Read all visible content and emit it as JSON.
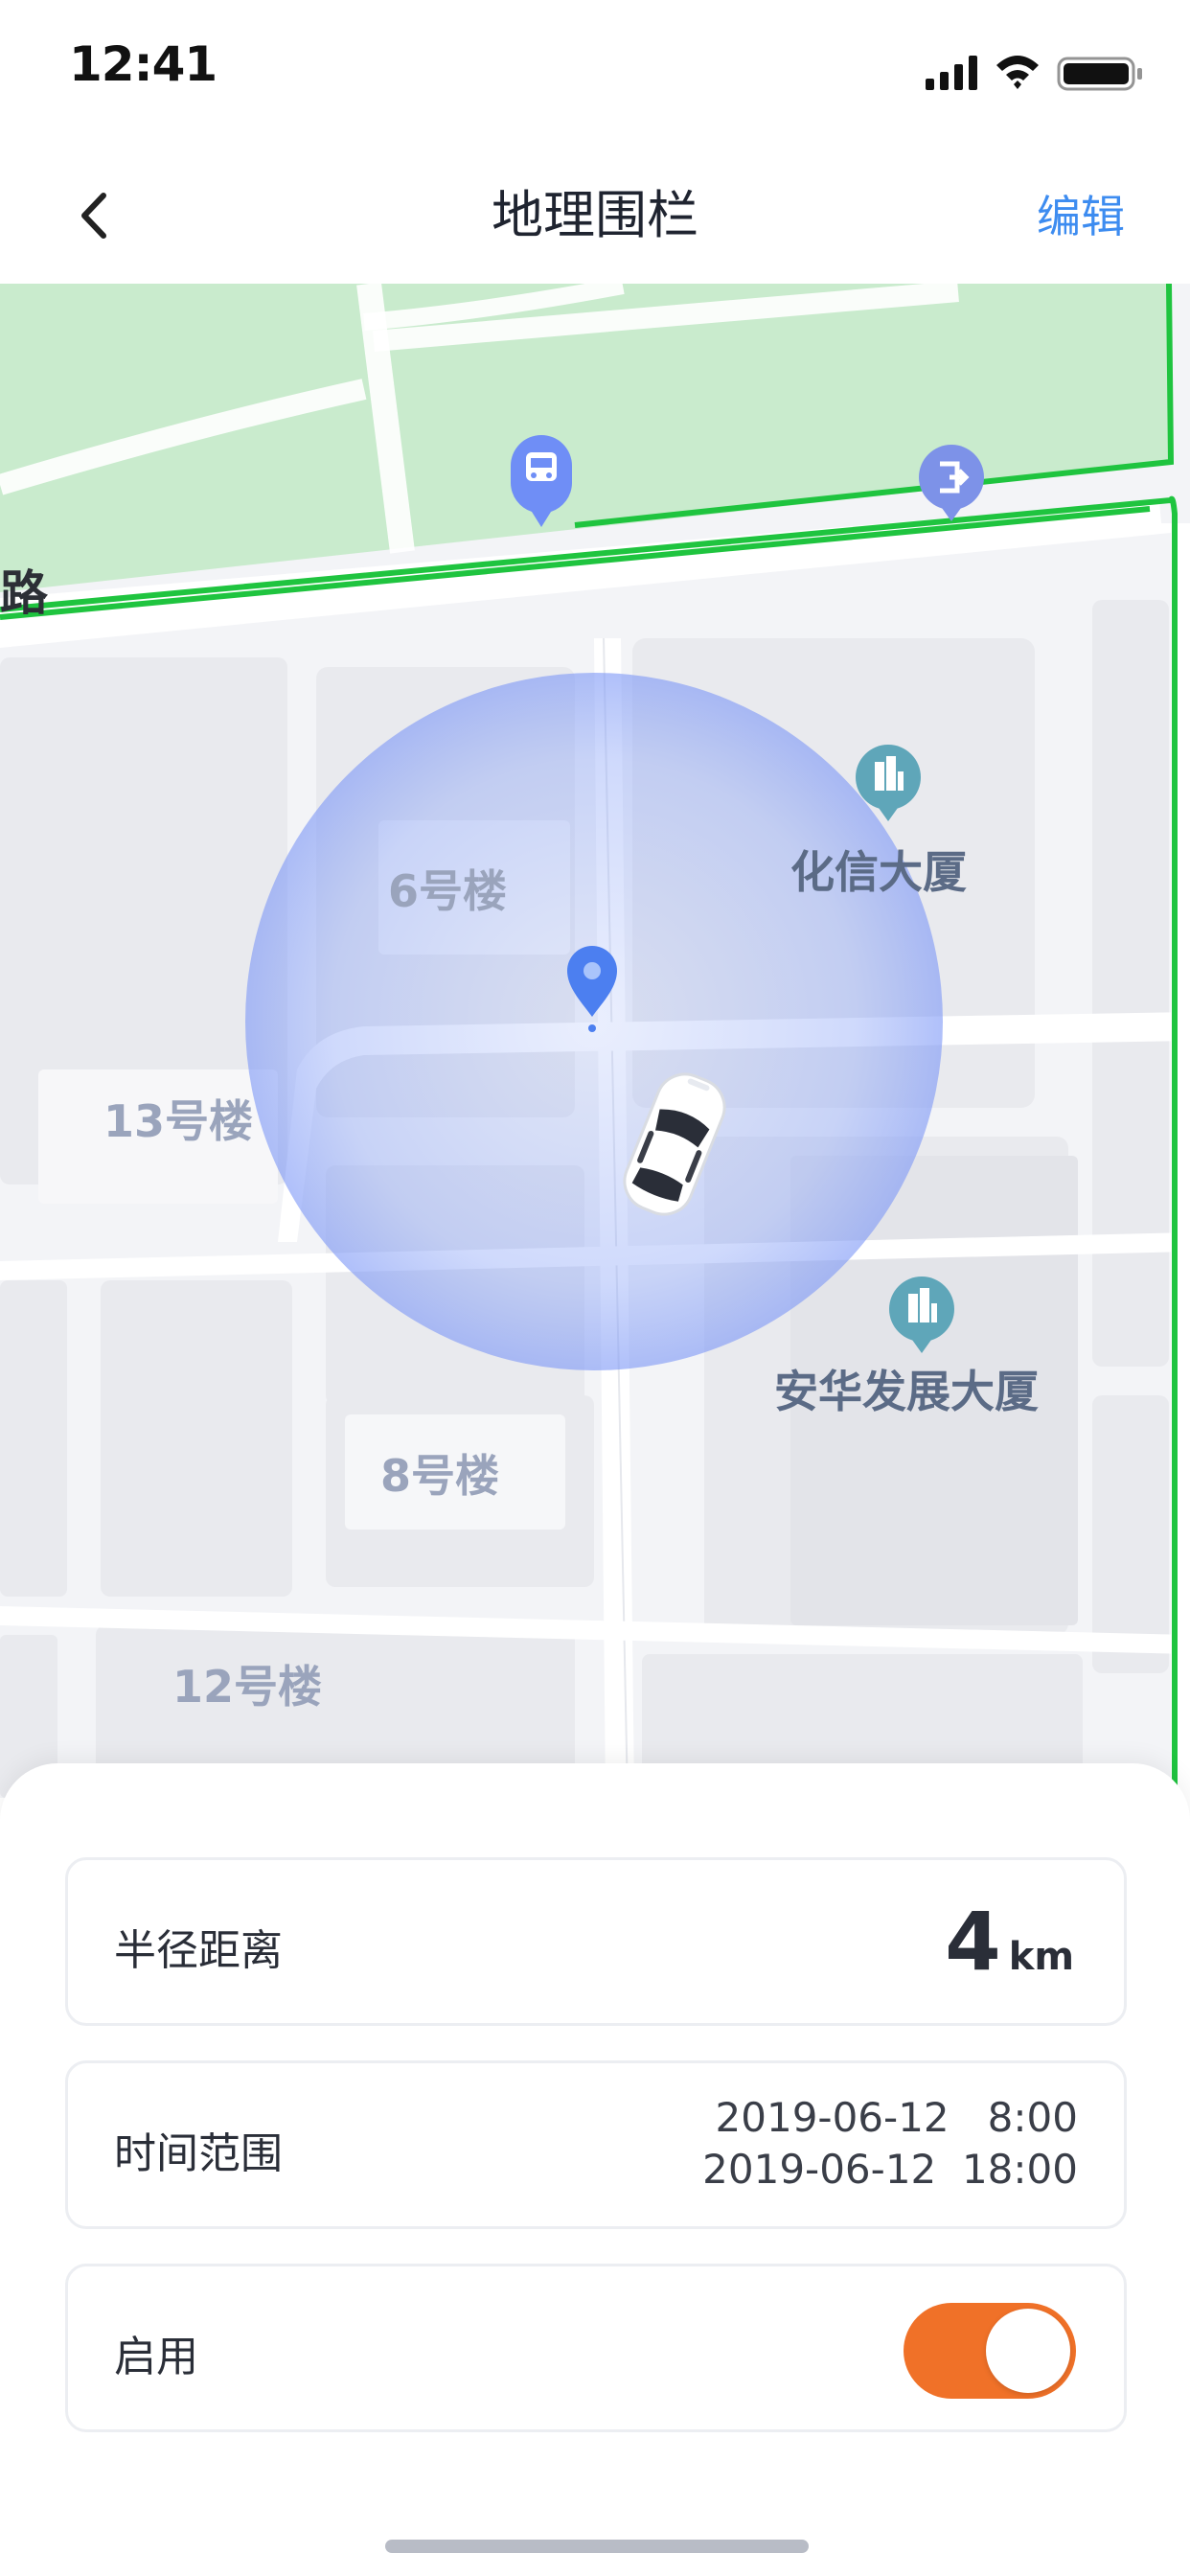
{
  "status_bar": {
    "time": "12:41",
    "icons": [
      "signal-icon",
      "wifi-icon",
      "battery-icon"
    ]
  },
  "nav": {
    "back_icon": "chevron-left-icon",
    "title": "地理围栏",
    "edit_label": "编辑"
  },
  "map": {
    "road_label": "路",
    "buildings": {
      "b6": "6号楼",
      "b13": "13号楼",
      "b8": "8号楼",
      "b12": "12号楼"
    },
    "pois": {
      "huaxin": "化信大厦",
      "anhua": "安华发展大厦"
    },
    "markers": [
      "bus-stop-icon",
      "subway-exit-icon",
      "location-pin-icon",
      "car-icon",
      "building-poi-icon"
    ],
    "colors": {
      "park": "#c9ebcd",
      "route": "#1fc43f",
      "fence": "#6f8ef6"
    }
  },
  "settings": {
    "radius": {
      "label": "半径距离",
      "value": "4",
      "unit": "km"
    },
    "time_range": {
      "label": "时间范围",
      "start": "2019-06-12   8:00",
      "end": "2019-06-12  18:00"
    },
    "enabled": {
      "label": "启用",
      "on": true
    }
  },
  "colors": {
    "accent": "#3d8cf0",
    "toggle_on": "#f07128"
  }
}
